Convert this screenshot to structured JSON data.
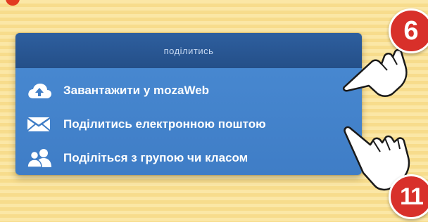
{
  "header": {
    "title": "поділитись"
  },
  "menu": {
    "items": [
      {
        "label": "Завантажити у mozaWeb",
        "icon": "cloud-upload-icon"
      },
      {
        "label": "Поділитись електронною поштою",
        "icon": "envelope-icon"
      },
      {
        "label": "Поділіться з групою чи класом",
        "icon": "users-group-icon"
      }
    ]
  },
  "callouts": {
    "badge_top": "6",
    "badge_bottom": "11"
  },
  "colors": {
    "panel_blue": "#3f7dc6",
    "header_blue": "#244f88",
    "badge_red": "#d8302a",
    "background_yellow": "#fbe7a6"
  }
}
